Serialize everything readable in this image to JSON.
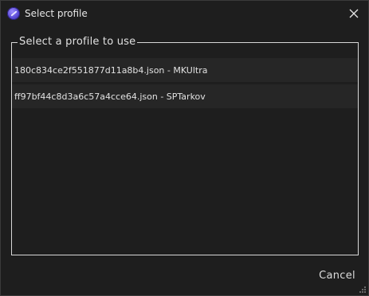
{
  "window": {
    "title": "Select profile",
    "icon": "app-logo-icon",
    "close_icon": "close-icon"
  },
  "group": {
    "legend": "Select a profile to use"
  },
  "profiles": [
    {
      "label": "180c834ce2f551877d11a8b4.json - MKUltra"
    },
    {
      "label": "ff97bf44c8d3a6c57a4cce64.json - SPTarkov"
    }
  ],
  "actions": {
    "cancel_label": "Cancel"
  },
  "colors": {
    "background": "#1e1e1e",
    "item_background": "#262626",
    "border": "#d8d8d8",
    "text": "#e2e2e2"
  }
}
